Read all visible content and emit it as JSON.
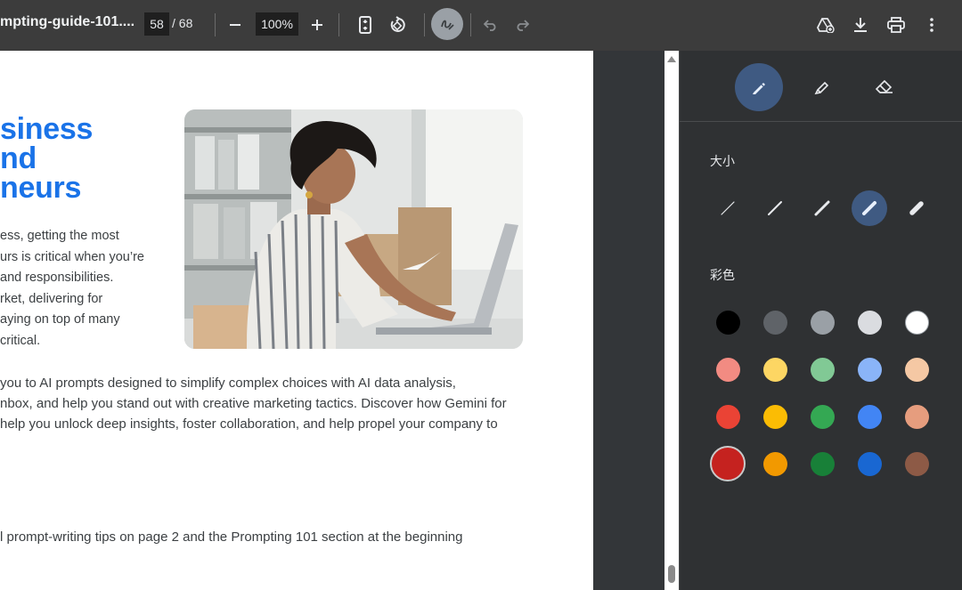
{
  "toolbar": {
    "doc_title": "mpting-guide-101....",
    "current_page": "58",
    "page_separator": "/ 68",
    "zoom": "100%"
  },
  "document": {
    "heading_lines": [
      "siness",
      "nd",
      "neurs"
    ],
    "intro_lines": [
      "ess, getting the most",
      "urs is critical when you’re",
      "and responsibilities.",
      "rket, delivering for",
      "aying on top of many",
      "critical."
    ],
    "body_lines": [
      " you to AI prompts designed to simplify complex choices with AI data analysis,",
      "nbox, and help you stand out with creative marketing tactics. Discover how Gemini for",
      " help you unlock deep insights, foster collaboration, and help propel your company to"
    ],
    "footnote": "l prompt-writing tips on page 2 and the Prompting 101 section at the beginning"
  },
  "panel": {
    "size_label": "大小",
    "color_label": "彩色",
    "colors": [
      [
        "#000000",
        "#5f6368",
        "#9aa0a6",
        "#dadce0",
        "#ffffff"
      ],
      [
        "#f28b82",
        "#fdd663",
        "#81c995",
        "#8ab4f8",
        "#f5c8a4"
      ],
      [
        "#ea4335",
        "#fbbc04",
        "#34a853",
        "#4285f4",
        "#e69d7e"
      ],
      [
        "#c5221f",
        "#f29900",
        "#188038",
        "#1967d2",
        "#8d5a46"
      ]
    ],
    "selected_color": "#c5221f"
  },
  "icons": [
    "minus-icon",
    "plus-icon",
    "fit-page-icon",
    "rotate-icon",
    "annotate-icon",
    "undo-icon",
    "redo-icon",
    "drive-save-icon",
    "download-icon",
    "print-icon",
    "more-icon",
    "pen-icon",
    "highlighter-icon",
    "eraser-icon"
  ]
}
